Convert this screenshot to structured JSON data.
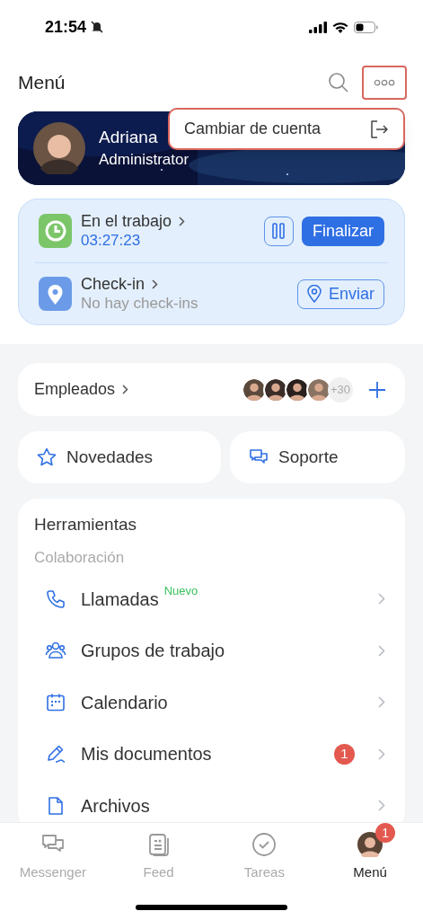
{
  "status_bar": {
    "time": "21:54"
  },
  "header": {
    "title": "Menú"
  },
  "dropdown": {
    "items": [
      {
        "label": "Cambiar de cuenta"
      }
    ]
  },
  "profile": {
    "name": "Adriana",
    "role": "Administrator"
  },
  "work": {
    "title": "En el trabajo",
    "timer": "03:27:23",
    "button": "Finalizar"
  },
  "checkin": {
    "title": "Check-in",
    "subtitle": "No hay check-ins",
    "button": "Enviar"
  },
  "employees": {
    "label": "Empleados",
    "more": "+30"
  },
  "shortcuts": [
    {
      "kind": "star",
      "label": "Novedades"
    },
    {
      "kind": "chat",
      "label": "Soporte"
    }
  ],
  "tools": {
    "title": "Herramientas",
    "section": "Colaboración",
    "items": [
      {
        "kind": "phone",
        "label": "Llamadas",
        "tag": "Nuevo"
      },
      {
        "kind": "group",
        "label": "Grupos de trabajo"
      },
      {
        "kind": "calendar",
        "label": "Calendario"
      },
      {
        "kind": "pen",
        "label": "Mis documentos",
        "badge": "1"
      },
      {
        "kind": "file",
        "label": "Archivos"
      }
    ]
  },
  "tab_bar": [
    {
      "kind": "chat",
      "label": "Messenger",
      "selected": false
    },
    {
      "kind": "feed",
      "label": "Feed",
      "selected": false
    },
    {
      "kind": "check",
      "label": "Tareas",
      "selected": false
    },
    {
      "kind": "avatar",
      "label": "Menú",
      "selected": true,
      "badge": "1"
    }
  ]
}
